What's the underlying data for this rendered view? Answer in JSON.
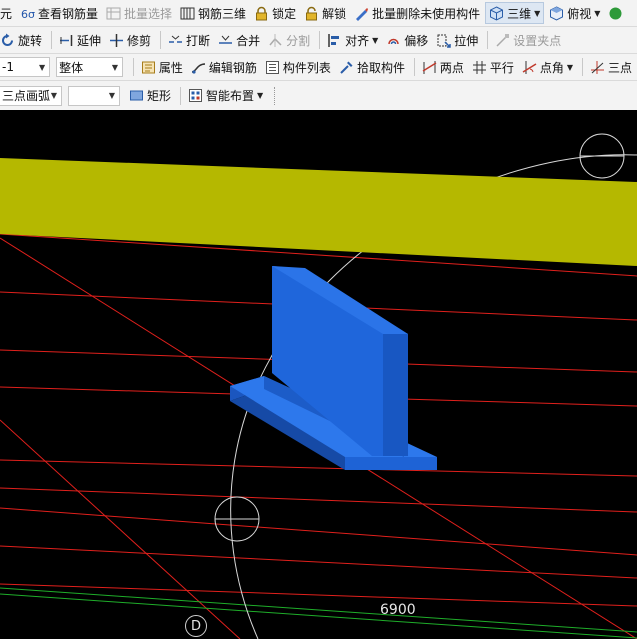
{
  "toolbar1": {
    "items": [
      {
        "label": "元",
        "icon": "partial-icon",
        "disabled": false
      },
      {
        "label": "查看钢筋量",
        "icon": "rebar-quantity-icon",
        "disabled": false
      },
      {
        "label": "批量选择",
        "icon": "batch-select-icon",
        "disabled": true
      },
      {
        "label": "钢筋三维",
        "icon": "rebar-3d-icon",
        "disabled": false
      },
      {
        "label": "锁定",
        "icon": "lock-icon",
        "disabled": false
      },
      {
        "label": "解锁",
        "icon": "unlock-icon",
        "disabled": false
      },
      {
        "label": "批量删除未使用构件",
        "icon": "batch-delete-icon",
        "disabled": false
      }
    ],
    "view_mode": "三维",
    "view_direction": "俯视"
  },
  "toolbar2": {
    "items": [
      {
        "label": "旋转",
        "icon": "rotate-icon",
        "disabled": false
      },
      {
        "label": "延伸",
        "icon": "extend-icon",
        "disabled": false
      },
      {
        "label": "修剪",
        "icon": "trim-icon",
        "disabled": false
      },
      {
        "label": "打断",
        "icon": "break-icon",
        "disabled": false
      },
      {
        "label": "合并",
        "icon": "merge-icon",
        "disabled": false
      },
      {
        "label": "分割",
        "icon": "split-icon",
        "disabled": true
      },
      {
        "label": "对齐",
        "icon": "align-icon",
        "disabled": false
      },
      {
        "label": "偏移",
        "icon": "offset-icon",
        "disabled": false
      },
      {
        "label": "拉伸",
        "icon": "stretch-icon",
        "disabled": false
      },
      {
        "label": "设置夹点",
        "icon": "grip-point-icon",
        "disabled": true
      }
    ]
  },
  "toolbar3": {
    "component_value": "-1",
    "scope_value": "整体",
    "items": [
      {
        "label": "属性",
        "icon": "properties-icon"
      },
      {
        "label": "编辑钢筋",
        "icon": "edit-rebar-icon"
      },
      {
        "label": "构件列表",
        "icon": "component-list-icon"
      },
      {
        "label": "拾取构件",
        "icon": "pick-component-icon"
      },
      {
        "label": "两点",
        "icon": "two-point-icon"
      },
      {
        "label": "平行",
        "icon": "parallel-icon"
      },
      {
        "label": "点角",
        "icon": "point-angle-icon"
      },
      {
        "label": "三点",
        "icon": "three-point-icon"
      }
    ]
  },
  "toolbar4": {
    "arc_mode_value": "三点画弧",
    "items": [
      {
        "label": "矩形",
        "icon": "rectangle-icon"
      },
      {
        "label": "智能布置",
        "icon": "smart-layout-icon"
      }
    ]
  },
  "viewport": {
    "dimension_label": "6900",
    "axis_label": "D",
    "colors": {
      "background": "#000000",
      "beam": "#b5b800",
      "component": "#1e63d6",
      "grid_red": "#e0201c",
      "grid_green": "#1fae2a",
      "guide_white": "#d8d8d8"
    }
  }
}
